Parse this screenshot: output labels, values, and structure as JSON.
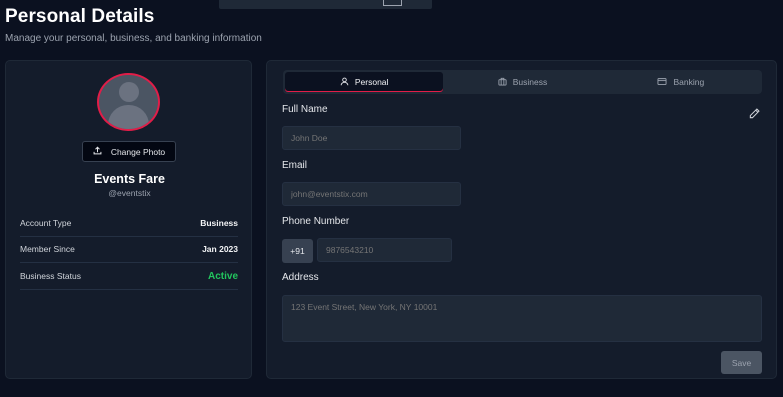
{
  "header": {
    "title": "Personal Details",
    "subtitle": "Manage your personal, business, and banking information"
  },
  "profile": {
    "change_photo_label": "Change Photo",
    "name": "Events Fare",
    "handle": "@eventstix",
    "info": [
      {
        "label": "Account Type",
        "value": "Business"
      },
      {
        "label": "Member Since",
        "value": "Jan 2023"
      },
      {
        "label": "Business Status",
        "value": "Active"
      }
    ],
    "accent_color": "#e11d48",
    "status_color": "#22c55e"
  },
  "tabs": [
    {
      "label": "Personal",
      "icon": "user-icon",
      "active": true
    },
    {
      "label": "Business",
      "icon": "briefcase-icon",
      "active": false
    },
    {
      "label": "Banking",
      "icon": "credit-card-icon",
      "active": false
    }
  ],
  "form": {
    "full_name": {
      "label": "Full Name",
      "placeholder": "John Doe",
      "value": ""
    },
    "email": {
      "label": "Email",
      "placeholder": "john@eventstix.com",
      "value": ""
    },
    "phone": {
      "label": "Phone Number",
      "country_code": "+91",
      "placeholder": "9876543210",
      "value": ""
    },
    "address": {
      "label": "Address",
      "placeholder": "123 Event Street, New York, NY 10001",
      "value": ""
    },
    "save_label": "Save",
    "edit_icon": "pencil-icon"
  }
}
